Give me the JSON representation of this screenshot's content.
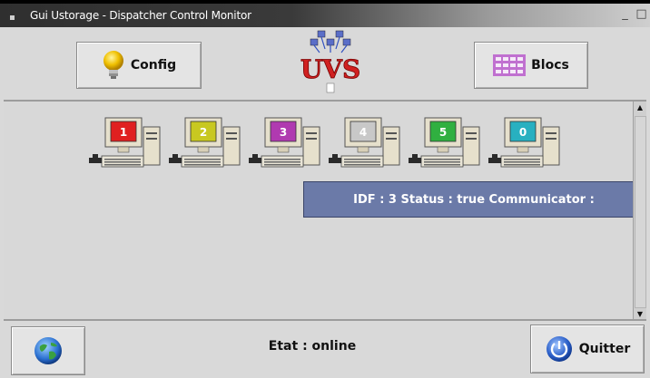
{
  "window": {
    "title": "Gui Ustorage - Dispatcher Control Monitor",
    "minimize_icon": "_",
    "maximize_icon": "□"
  },
  "toolbar": {
    "config_label": "Config",
    "blocs_label": "Blocs",
    "logo_text": "UVS"
  },
  "stations": [
    {
      "id": "1",
      "color": "#e02020"
    },
    {
      "id": "2",
      "color": "#c8c820"
    },
    {
      "id": "3",
      "color": "#b03ab0"
    },
    {
      "id": "4",
      "color": "#c8c8c8"
    },
    {
      "id": "5",
      "color": "#30b040"
    },
    {
      "id": "0",
      "color": "#28b0c0"
    }
  ],
  "tooltip": {
    "text": "IDF : 3  Status : true Communicator :"
  },
  "statusbar": {
    "status_text": "Etat : online",
    "quit_label": "Quitter"
  },
  "icons": {
    "config": "lightbulb-icon",
    "blocs": "blocks-grid-icon",
    "globe": "globe-icon",
    "quit": "power-icon"
  }
}
